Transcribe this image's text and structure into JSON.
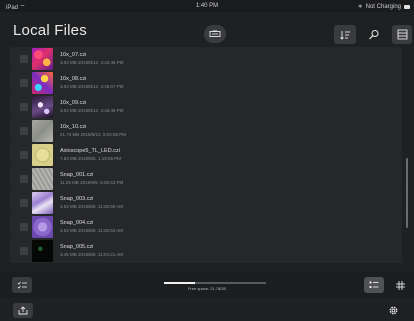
{
  "status_bar": {
    "device": "iPad",
    "time": "1:40 PM",
    "battery": "Not Charging"
  },
  "header": {
    "title": "Local Files"
  },
  "files": [
    {
      "name": "10x_07.czi",
      "meta": "3.03 MB 2019/8/12, 4:42:45 PM"
    },
    {
      "name": "10x_08.czi",
      "meta": "3.03 MB 2019/8/12, 4:45:07 PM"
    },
    {
      "name": "10x_09.czi",
      "meta": "3.04 MB 2019/8/12, 4:46:49 PM"
    },
    {
      "name": "10x_10.czi",
      "meta": "21.73 MB 2019/8/12, 5:04:58 PM"
    },
    {
      "name": "Axioscope5_TL_LED.czi",
      "meta": "7.83 MB 2019/8/6, 1:19:55 PM"
    },
    {
      "name": "Snap_001.czi",
      "meta": "11.03 MB 2019/9/5, 5:08:43 PM"
    },
    {
      "name": "Snap_003.czi",
      "meta": "3.53 MB 2019/8/6, 11:20:58 AM"
    },
    {
      "name": "Snap_004.czi",
      "meta": "3.53 MB 2019/8/6, 11:20:53 AM"
    },
    {
      "name": "Snap_005.czi",
      "meta": "3.46 MB 2019/8/6, 11:04:21 AM"
    }
  ],
  "footer": {
    "free_space": "Free space:  21.78GB",
    "free_space_used_fraction": 0.3
  },
  "icons": {
    "camera": "camera-icon",
    "sort": "sort-icon",
    "search": "search-icon",
    "archive": "archive-icon",
    "select": "select-list-icon",
    "list_view": "list-view-icon",
    "grid_view": "grid-view-icon",
    "export": "export-icon",
    "settings": "gear-icon"
  }
}
